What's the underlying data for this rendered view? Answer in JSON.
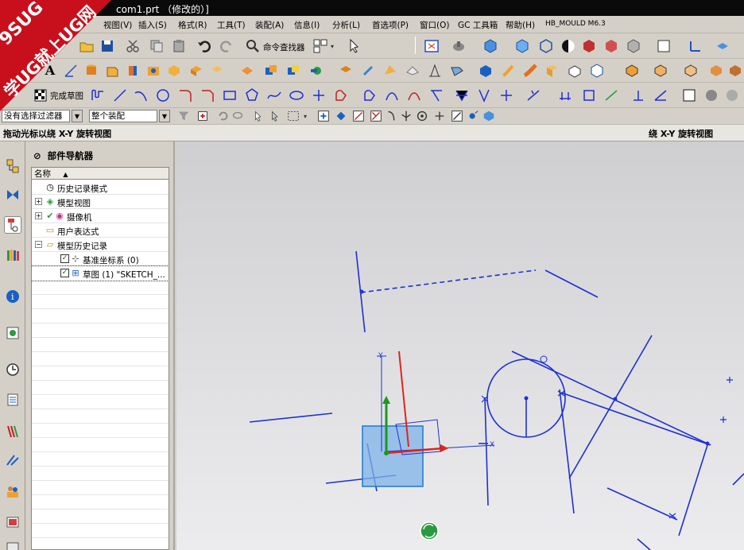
{
  "window": {
    "title": "com1.prt （修改的）]"
  },
  "logo": {
    "line1": "9SUG",
    "line2": "学UG就上UG网"
  },
  "menu": [
    {
      "label": "视图(V)"
    },
    {
      "label": "插入(S)"
    },
    {
      "label": "格式(R)"
    },
    {
      "label": "工具(T)"
    },
    {
      "label": "装配(A)"
    },
    {
      "label": "信息(I)"
    },
    {
      "label": "分析(L)"
    },
    {
      "label": "首选项(P)"
    },
    {
      "label": "窗口(O)"
    },
    {
      "label": "GC 工具箱"
    },
    {
      "label": "帮助(H)"
    },
    {
      "label": "HB_MOULD M6.3"
    }
  ],
  "toolbar": {
    "command_finder": "命令查找器",
    "finish_sketch": "完成草图",
    "text_tool": "A",
    "filter_value": "没有选择过滤器",
    "assembly_scope": "整个装配"
  },
  "status": {
    "left": "拖动光标以绕 X-Y 旋转视图",
    "right": "绕 X-Y 旋转视图"
  },
  "navigator": {
    "title": "部件导航器",
    "column_header": "名称",
    "items": [
      {
        "label": "历史记录模式",
        "icon": "clock-icon"
      },
      {
        "label": "模型视图",
        "icon": "model-views-icon"
      },
      {
        "label": "摄像机",
        "icon": "camera-icon"
      },
      {
        "label": "用户表达式",
        "icon": "folder-icon"
      },
      {
        "label": "模型历史记录",
        "icon": "folder-open-icon"
      },
      {
        "label": "基准坐标系 (0)",
        "icon": "datum-csys-icon"
      },
      {
        "label": "草图 (1) \"SKETCH_...",
        "icon": "sketch-icon"
      }
    ]
  },
  "colors": {
    "sketch_blue": "#1f2fd6",
    "datum_red": "#e0241a",
    "datum_green": "#1a9a1a",
    "csys_cube": "#7fb3e8"
  }
}
